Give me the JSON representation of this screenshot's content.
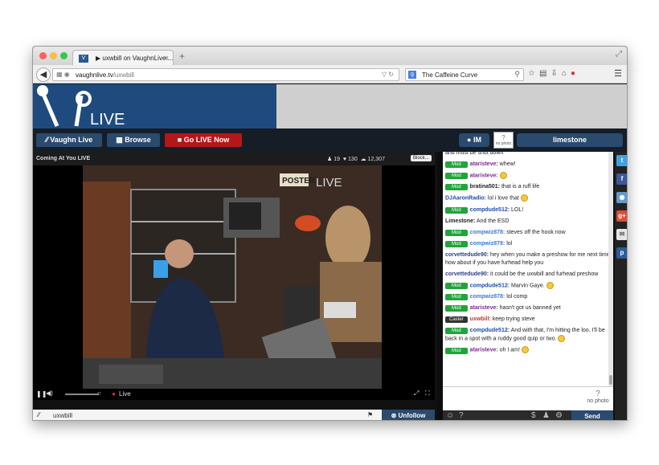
{
  "browser": {
    "tab_title": "▶ uxwbill on VaughnLive....",
    "tab_close": "×",
    "new_tab": "+",
    "url_domain": "vaughnlive.tv",
    "url_path": "/uxwbill",
    "search_value": "The Caffeine Curve"
  },
  "site": {
    "logo_text": "LIVE",
    "nav": {
      "vaughn_live": "Vaughn Live",
      "browse": "Browse",
      "go_live": "Go LIVE Now",
      "im": "IM",
      "nophoto": "no photo",
      "username": "limestone"
    }
  },
  "video": {
    "title": "Coming At You LIVE",
    "stat_a": "19",
    "stat_b": "130",
    "stat_c": "12,307",
    "block_label": "Block...",
    "live_label": "Live",
    "channel": "uxwbill",
    "unfollow_label": "Unfollow",
    "scene_sign": "POSTER",
    "scene_logo": "LIVE"
  },
  "chat": {
    "cutoff_text": "and must be shut down",
    "messages": [
      {
        "badge": "Mod",
        "user": "ataristeve:",
        "text": "whew!",
        "color": "#7a2a8a",
        "smile": false
      },
      {
        "badge": "Mod",
        "user": "ataristeve:",
        "text": "",
        "color": "#7a2a8a",
        "smile": true
      },
      {
        "badge": "Mod",
        "user": "bratina501:",
        "text": "that is a ruff life",
        "color": "#222222",
        "smile": false
      },
      {
        "badge": "",
        "user": "DJAaronRadio:",
        "text": "lol i love that",
        "color": "#1f4ea8",
        "smile": true
      },
      {
        "badge": "Mod",
        "user": "compdude512:",
        "text": "LOL!",
        "color": "#1f4ea8",
        "smile": false
      },
      {
        "badge": "",
        "user": "Limestone:",
        "text": "And the ESD",
        "color": "#222222",
        "smile": false
      },
      {
        "badge": "Mod",
        "user": "compwiz878:",
        "text": "steves off the hook now",
        "color": "#3a7bd5",
        "smile": false
      },
      {
        "badge": "Mod",
        "user": "compwiz878:",
        "text": "lol",
        "color": "#3a7bd5",
        "smile": false
      },
      {
        "badge": "",
        "user": "corvettedude90:",
        "text": "hey when you make a preshow for me next time how about if you have furhead help you",
        "color": "#2a3f8a",
        "smile": false
      },
      {
        "badge": "",
        "user": "corvettedude90:",
        "text": "it could be the uxwbill and furhead preshow",
        "color": "#2a3f8a",
        "smile": false
      },
      {
        "badge": "Mod",
        "user": "compdude512:",
        "text": "Marvin Gaye.",
        "color": "#1f4ea8",
        "smile": true
      },
      {
        "badge": "Mod",
        "user": "compwiz878:",
        "text": "lol comp",
        "color": "#3a7bd5",
        "smile": false
      },
      {
        "badge": "Mod",
        "user": "ataristeve:",
        "text": "hasn't got us banned yet",
        "color": "#7a2a8a",
        "smile": false
      },
      {
        "badge": "Caster",
        "user": "uxwbill:",
        "text": "keep trying steve",
        "color": "#c0392b",
        "smile": false
      },
      {
        "badge": "Mod",
        "user": "compdude512:",
        "text": "And with that, I'm hitting the loo. I'll be back in a spot with a ruddy good quip or two.",
        "color": "#1f4ea8",
        "smile": true
      },
      {
        "badge": "Mod",
        "user": "ataristeve:",
        "text": "oh I am!",
        "color": "#7a2a8a",
        "smile": true
      }
    ],
    "nophoto_label": "no photo",
    "send_label": "Send"
  },
  "social": [
    "twitter",
    "facebook",
    "reddit",
    "google-plus",
    "email",
    "pinterest"
  ],
  "colors": {
    "accent": "#2a4a6e",
    "golive": "#b3171a",
    "mod": "#21a43a",
    "banner": "#1f4a7e"
  }
}
